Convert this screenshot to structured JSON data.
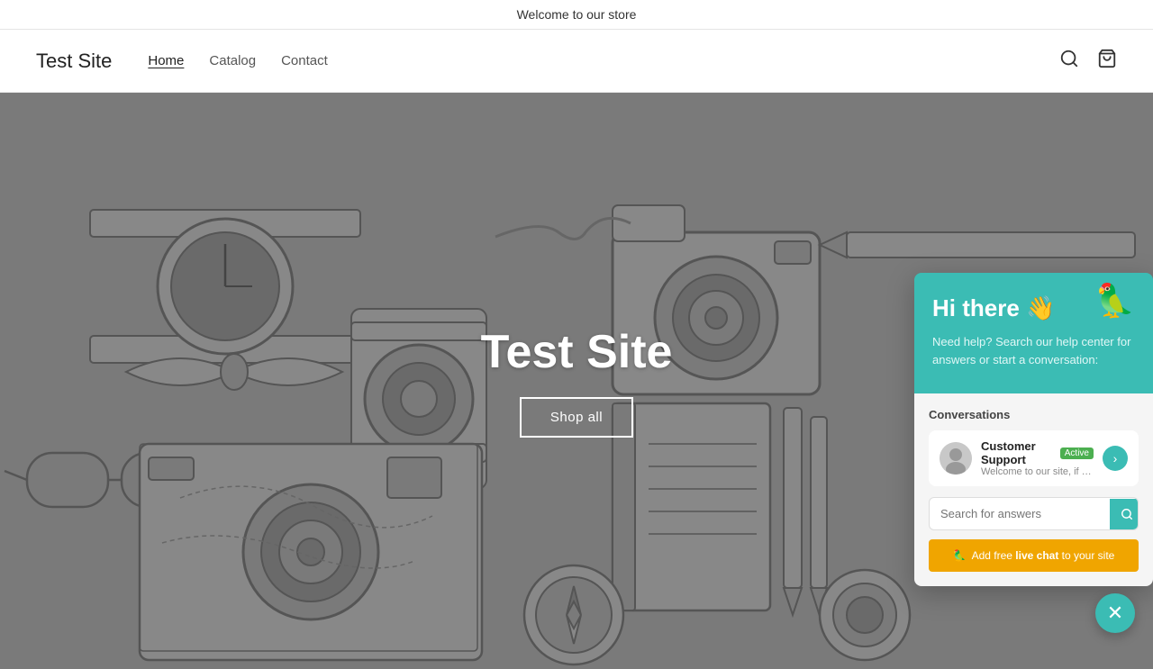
{
  "announcement": {
    "text": "Welcome to our store"
  },
  "header": {
    "logo": "Test Site",
    "nav": [
      {
        "label": "Home",
        "active": true
      },
      {
        "label": "Catalog",
        "active": false
      },
      {
        "label": "Contact",
        "active": false
      }
    ],
    "icons": {
      "search": "🔍",
      "cart": "🛒"
    }
  },
  "hero": {
    "title": "Test Site",
    "cta_label": "Shop all"
  },
  "chat_widget": {
    "greeting": "Hi there 👋",
    "subtitle": "Need help? Search our help center for answers or start a conversation:",
    "bird_emoji": "🦜",
    "conversations_label": "Conversations",
    "conversation": {
      "agent_name": "Customer Support",
      "active_label": "Active",
      "preview": "Welcome to our site, if you ne..."
    },
    "search_placeholder": "Search for answers",
    "footer_text": "Add free ",
    "footer_bold": "live chat",
    "footer_suffix": " to your site",
    "footer_emoji": "🦜",
    "dismiss_symbol": "✕"
  },
  "colors": {
    "teal": "#3bbcb4",
    "active_green": "#4caf50",
    "amber": "#f0a500"
  }
}
